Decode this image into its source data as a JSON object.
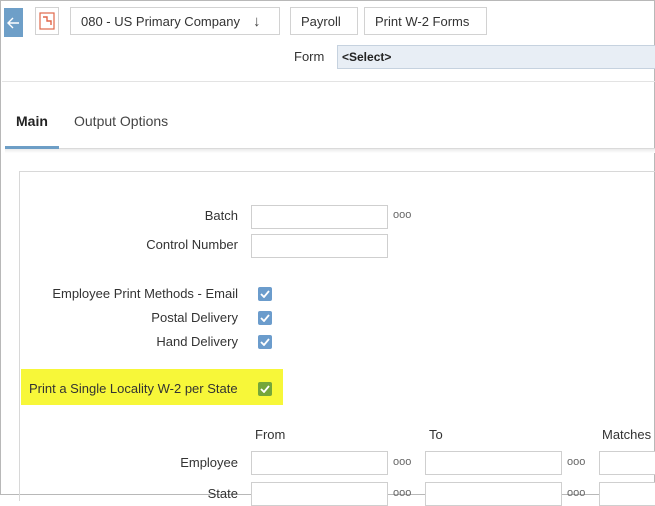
{
  "breadcrumb": {
    "company": "080 - US Primary Company",
    "company_arrow": "↓",
    "module": "Payroll",
    "page": "Print W-2 Forms"
  },
  "header": {
    "form_label": "Form",
    "form_value": "<Select>"
  },
  "tabs": [
    {
      "label": "Main",
      "active": true
    },
    {
      "label": "Output Options",
      "active": false
    }
  ],
  "fields": {
    "batch_label": "Batch",
    "control_number_label": "Control Number",
    "employee_print_email_label": "Employee Print Methods - Email",
    "postal_delivery_label": "Postal Delivery",
    "hand_delivery_label": "Hand Delivery",
    "single_locality_label": "Print a Single Locality W-2 per State",
    "dots": "ooo"
  },
  "checkboxes": {
    "email": true,
    "postal": true,
    "hand": true,
    "single_locality": true
  },
  "range": {
    "from_label": "From",
    "to_label": "To",
    "matches_label": "Matches",
    "employee_label": "Employee",
    "state_label": "State"
  },
  "colors": {
    "accent": "#6e9fc8",
    "checkbox": "#6b9ccc",
    "checkbox_highlight": "#74a63a",
    "highlight": "#f7f739"
  }
}
